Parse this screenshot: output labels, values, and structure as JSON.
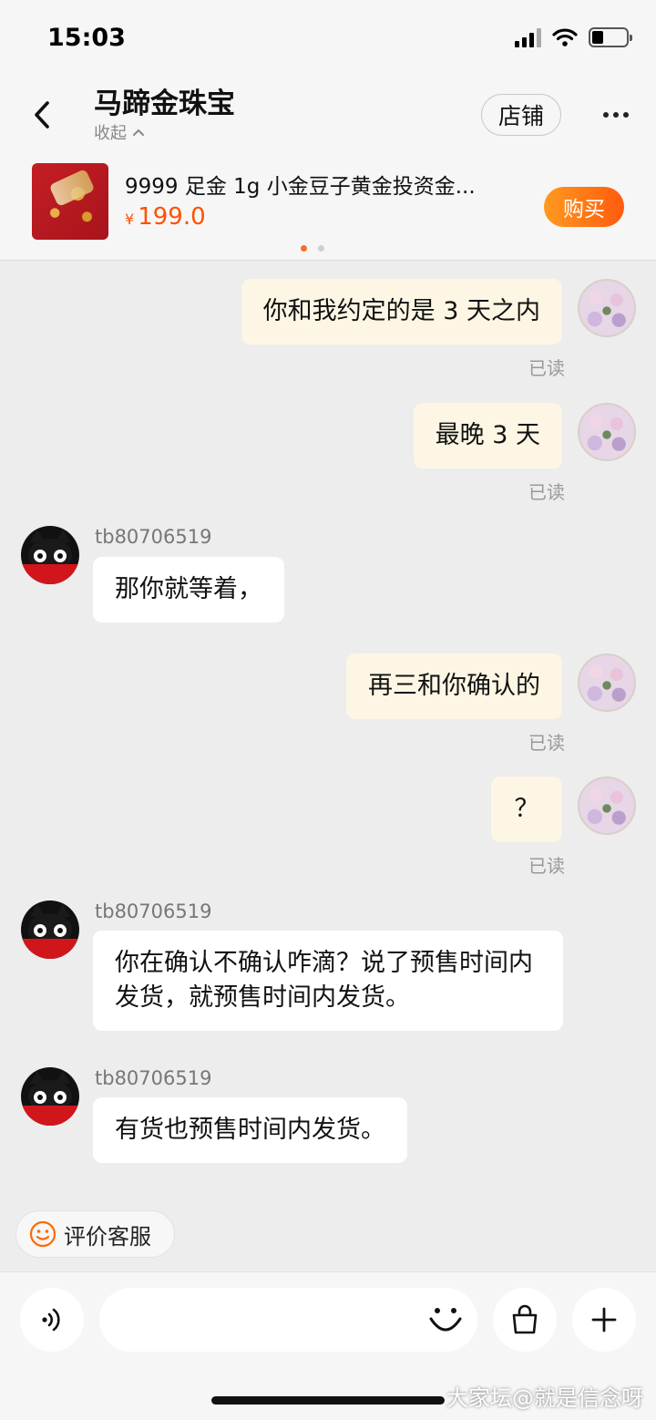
{
  "status_bar": {
    "time": "15:03"
  },
  "header": {
    "shop_name": "马蹄金珠宝",
    "collapse_label": "收起",
    "store_button": "店铺"
  },
  "product": {
    "title": "9999 足金 1g 小金豆子黄金投资金...",
    "currency": "¥",
    "price": "199.0",
    "buy_button": "购买",
    "carousel_page": 1,
    "carousel_total": 2
  },
  "messages": [
    {
      "side": "me",
      "text": "你和我约定的是 3 天之内",
      "status": "已读"
    },
    {
      "side": "me",
      "text": "最晚 3 天",
      "status": "已读"
    },
    {
      "side": "them",
      "sender": "tb80706519",
      "text": "那你就等着，"
    },
    {
      "side": "me",
      "text": "再三和你确认的",
      "status": "已读"
    },
    {
      "side": "me",
      "text": "？",
      "status": "已读"
    },
    {
      "side": "them",
      "sender": "tb80706519",
      "text": "你在确认不确认咋滴？说了预售时间内发货，就预售时间内发货。"
    },
    {
      "side": "them",
      "sender": "tb80706519",
      "text": "有货也预售时间内发货。"
    }
  ],
  "rate_service": {
    "label": "评价客服"
  },
  "input": {
    "placeholder": ""
  },
  "watermark": "大家坛@就是信念呀",
  "colors": {
    "accent": "#ff5000",
    "my_bubble": "#fdf6e4",
    "their_bubble": "#ffffff",
    "background": "#ededed"
  }
}
